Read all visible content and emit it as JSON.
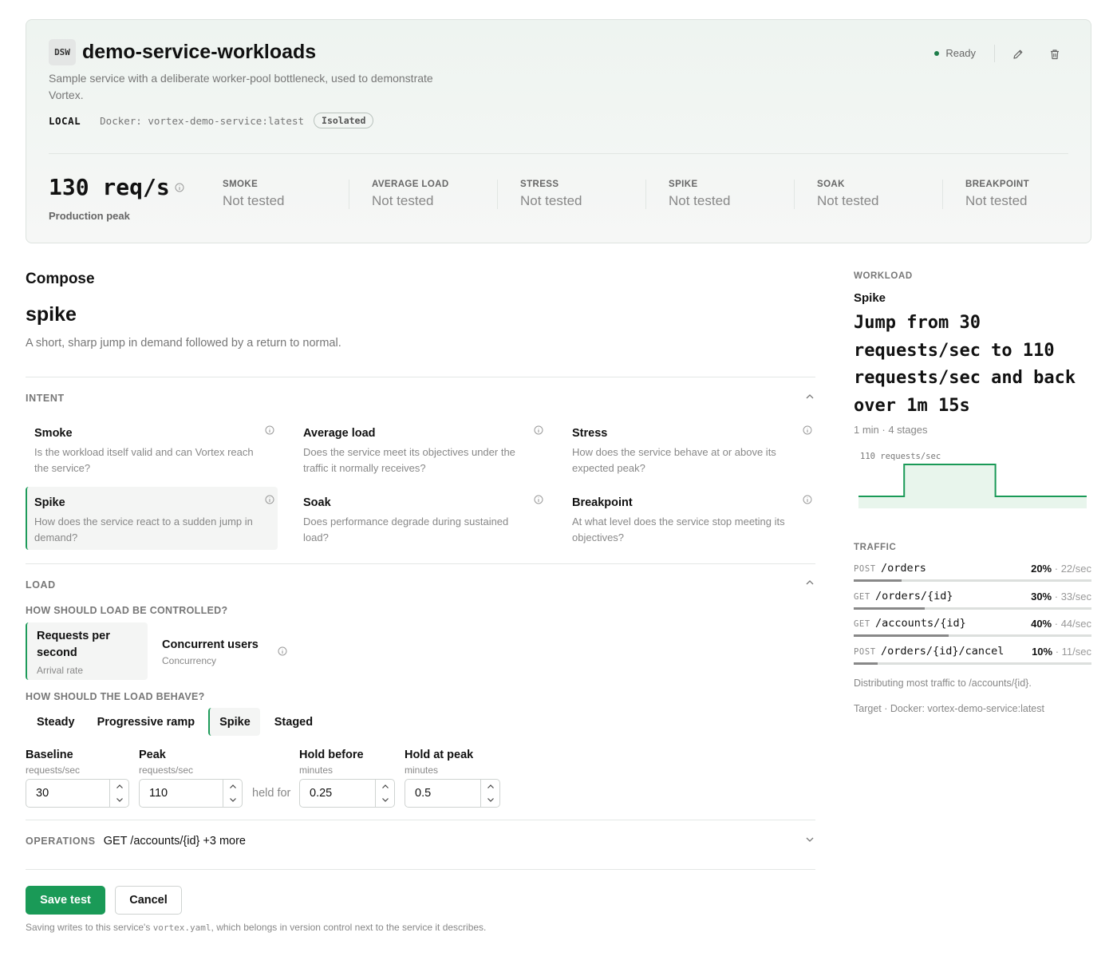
{
  "service": {
    "abbr": "DSW",
    "name": "demo-service-workloads",
    "description": "Sample service with a deliberate worker-pool bottleneck, used to demonstrate Vortex.",
    "location": "LOCAL",
    "docker": "Docker: vortex-demo-service:latest",
    "isolation": "Isolated",
    "status": "Ready",
    "status_color": "#1e7d4a",
    "rps": "130 req/s",
    "rps_label": "Production peak",
    "stats": [
      {
        "label": "SMOKE",
        "value": "Not tested"
      },
      {
        "label": "AVERAGE LOAD",
        "value": "Not tested"
      },
      {
        "label": "STRESS",
        "value": "Not tested"
      },
      {
        "label": "SPIKE",
        "value": "Not tested"
      },
      {
        "label": "SOAK",
        "value": "Not tested"
      },
      {
        "label": "BREAKPOINT",
        "value": "Not tested"
      }
    ]
  },
  "compose": {
    "heading": "Compose",
    "test_name": "spike",
    "test_description": "A short, sharp jump in demand followed by a return to normal.",
    "intent_label": "INTENT",
    "intents": [
      {
        "title": "Smoke",
        "desc": "Is the workload itself valid and can Vortex reach the service?"
      },
      {
        "title": "Average load",
        "desc": "Does the service meet its objectives under the traffic it normally receives?"
      },
      {
        "title": "Stress",
        "desc": "How does the service behave at or above its expected peak?"
      },
      {
        "title": "Spike",
        "desc": "How does the service react to a sudden jump in demand?"
      },
      {
        "title": "Soak",
        "desc": "Does performance degrade during sustained load?"
      },
      {
        "title": "Breakpoint",
        "desc": "At what level does the service stop meeting its objectives?"
      }
    ],
    "load_label": "LOAD",
    "control_question": "HOW SHOULD LOAD BE CONTROLLED?",
    "controls": [
      {
        "title": "Requests per second",
        "sub": "Arrival rate"
      },
      {
        "title": "Concurrent users",
        "sub": "Concurrency"
      }
    ],
    "behave_question": "HOW SHOULD THE LOAD BEHAVE?",
    "behaviors": [
      "Steady",
      "Progressive ramp",
      "Spike",
      "Staged"
    ],
    "fields": {
      "baseline": {
        "label": "Baseline",
        "unit": "requests/sec",
        "value": "30"
      },
      "peak": {
        "label": "Peak",
        "unit": "requests/sec",
        "value": "110"
      },
      "held_for": "held for",
      "hold_before": {
        "label": "Hold before",
        "unit": "minutes",
        "value": "0.25"
      },
      "hold_peak": {
        "label": "Hold at peak",
        "unit": "minutes",
        "value": "0.5"
      }
    },
    "operations_label": "OPERATIONS",
    "operations_summary": "GET /accounts/{id} +3 more",
    "save_label": "Save test",
    "cancel_label": "Cancel",
    "footnote_pre": "Saving writes to this service's ",
    "footnote_code": "vortex.yaml",
    "footnote_post": ", which belongs in version control next to the service it describes."
  },
  "workload": {
    "label": "WORKLOAD",
    "name": "Spike",
    "headline": "Jump from 30 requests/sec to 110 requests/sec and back over 1m 15s",
    "summary": "1 min · 4 stages",
    "chart_label": "110 requests/sec",
    "accent": "#1a9a57",
    "shape": {
      "baseline": 30,
      "peak": 110,
      "hold_before_min": 0.25,
      "hold_peak_min": 0.5,
      "total_min": 1.25
    }
  },
  "traffic": {
    "label": "TRAFFIC",
    "rows": [
      {
        "method": "POST",
        "path": "/orders",
        "pct": "20%",
        "rate": "· 22/sec",
        "share": 0.2
      },
      {
        "method": "GET",
        "path": "/orders/{id}",
        "pct": "30%",
        "rate": "· 33/sec",
        "share": 0.3
      },
      {
        "method": "GET",
        "path": "/accounts/{id}",
        "pct": "40%",
        "rate": "· 44/sec",
        "share": 0.4
      },
      {
        "method": "POST",
        "path": "/orders/{id}/cancel",
        "pct": "10%",
        "rate": "· 11/sec",
        "share": 0.1
      }
    ],
    "note": "Distributing most traffic to /accounts/{id}.",
    "target": "Target · Docker: vortex-demo-service:latest"
  }
}
